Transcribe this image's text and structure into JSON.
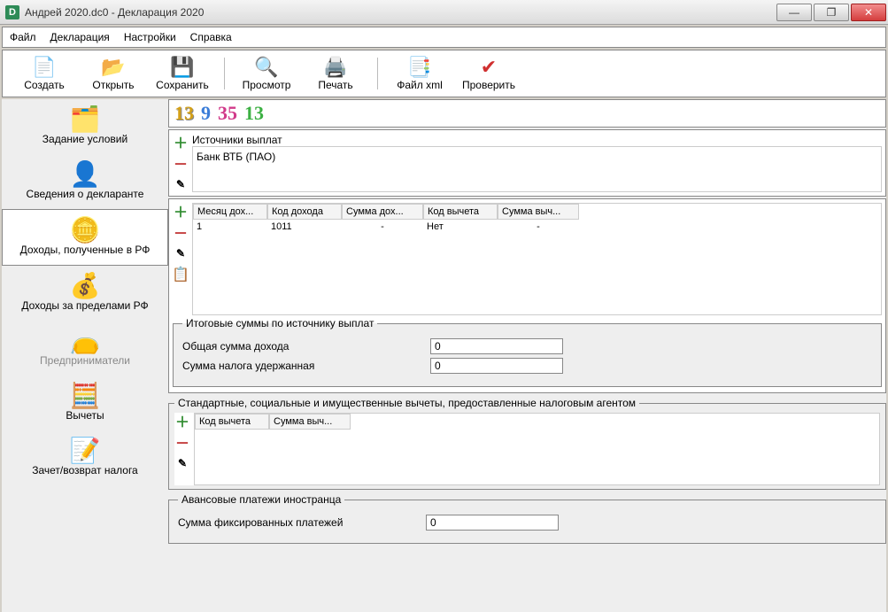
{
  "window": {
    "title": "Андрей 2020.dc0 - Декларация 2020",
    "appGlyph": "D"
  },
  "menu": {
    "file": "Файл",
    "declaration": "Декларация",
    "settings": "Настройки",
    "help": "Справка"
  },
  "toolbar": {
    "create": "Создать",
    "open": "Открыть",
    "save": "Сохранить",
    "preview": "Просмотр",
    "print": "Печать",
    "filexml": "Файл xml",
    "check": "Проверить"
  },
  "sidebar": {
    "conditions": "Задание условий",
    "declarant": "Сведения о декларанте",
    "income_rf": "Доходы, полученные в РФ",
    "income_foreign": "Доходы за пределами РФ",
    "entrepreneur": "Предприниматели",
    "deductions": "Вычеты",
    "refund": "Зачет/возврат налога"
  },
  "rates": {
    "r13a": "13",
    "r9": "9",
    "r35": "35",
    "r13b": "13"
  },
  "sources": {
    "title": "Источники выплат",
    "items": [
      {
        "name": "Банк ВТБ (ПАО)"
      }
    ]
  },
  "incomes": {
    "headers": {
      "month": "Месяц дох...",
      "code": "Код дохода",
      "sum": "Сумма дох...",
      "dedcode": "Код вычета",
      "dedsum": "Сумма выч..."
    },
    "rows": [
      {
        "month": "1",
        "code": "1011",
        "sum": "-",
        "dedcode": "Нет",
        "dedsum": "-"
      }
    ]
  },
  "totals": {
    "legend": "Итоговые суммы по источнику выплат",
    "total_income_label": "Общая сумма дохода",
    "total_income_value": "0",
    "tax_withheld_label": "Сумма налога удержанная",
    "tax_withheld_value": "0"
  },
  "agent_deductions": {
    "legend": "Стандартные, социальные и имущественные вычеты, предоставленные налоговым агентом",
    "headers": {
      "code": "Код вычета",
      "sum": "Сумма выч..."
    }
  },
  "advance": {
    "legend": "Авансовые платежи иностранца",
    "fixed_label": "Сумма фиксированных платежей",
    "fixed_value": "0"
  }
}
